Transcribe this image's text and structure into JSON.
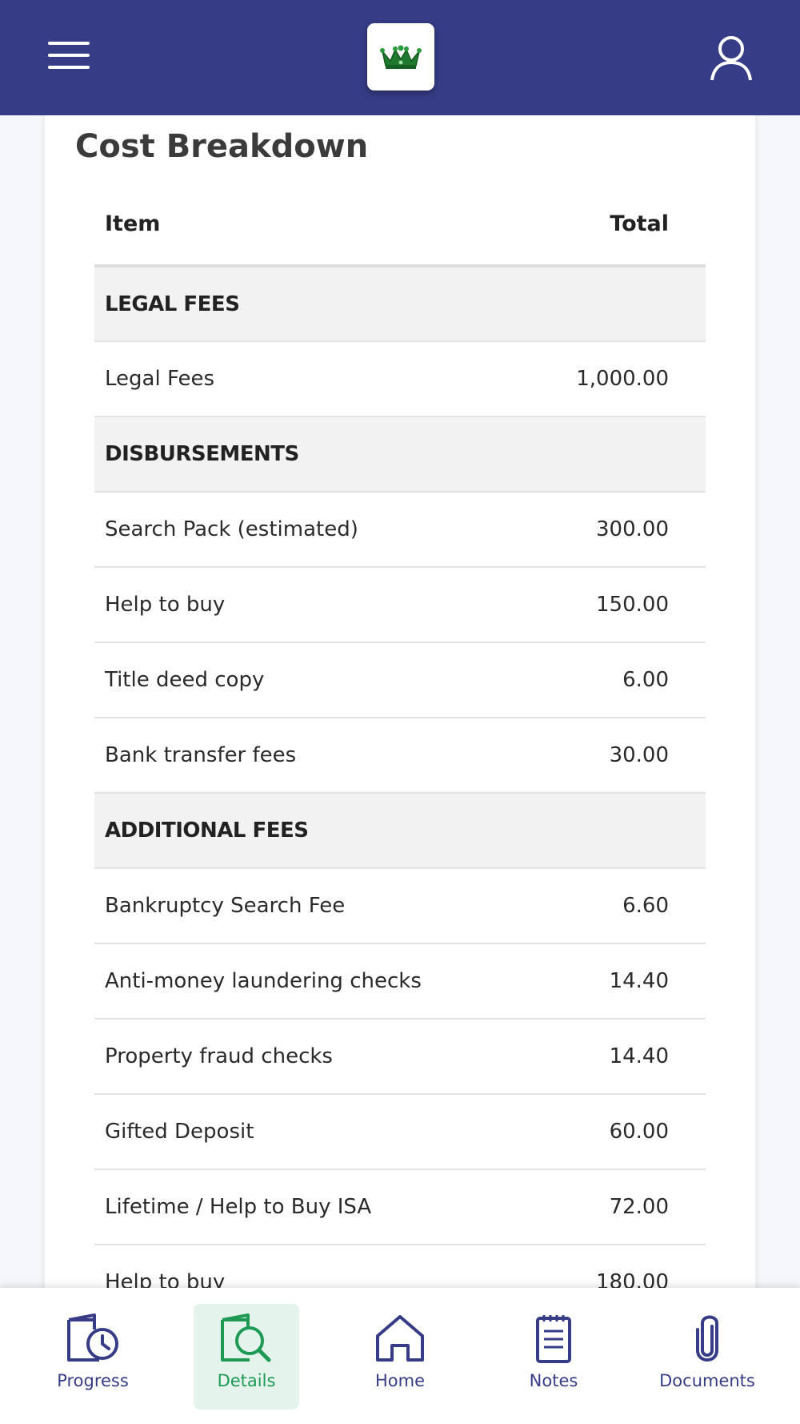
{
  "header": {
    "menu_icon": "hamburger-menu-icon",
    "logo_icon": "crown-logo-icon",
    "profile_icon": "user-profile-icon",
    "brand_color": "#363c85"
  },
  "card": {
    "title": "Cost Breakdown",
    "columns": {
      "item": "Item",
      "total": "Total"
    },
    "rows": [
      {
        "type": "section",
        "label": "LEGAL FEES"
      },
      {
        "type": "item",
        "label": "Legal Fees",
        "total": "1,000.00"
      },
      {
        "type": "section",
        "label": "DISBURSEMENTS"
      },
      {
        "type": "item",
        "label": "Search Pack (estimated)",
        "total": "300.00"
      },
      {
        "type": "item",
        "label": "Help to buy",
        "total": "150.00"
      },
      {
        "type": "item",
        "label": "Title deed copy",
        "total": "6.00"
      },
      {
        "type": "item",
        "label": "Bank transfer fees",
        "total": "30.00"
      },
      {
        "type": "section",
        "label": "ADDITIONAL FEES"
      },
      {
        "type": "item",
        "label": "Bankruptcy Search Fee",
        "total": "6.60"
      },
      {
        "type": "item",
        "label": "Anti-money laundering checks",
        "total": "14.40"
      },
      {
        "type": "item",
        "label": "Property fraud checks",
        "total": "14.40"
      },
      {
        "type": "item",
        "label": "Gifted Deposit",
        "total": "60.00"
      },
      {
        "type": "item",
        "label": "Lifetime / Help to Buy ISA",
        "total": "72.00"
      },
      {
        "type": "item",
        "label": "Help to buy",
        "total": "180.00"
      }
    ]
  },
  "nav": {
    "active_color": "#1e9a55",
    "items": [
      {
        "label": "Progress",
        "icon": "progress-clock-icon",
        "active": false
      },
      {
        "label": "Details",
        "icon": "details-search-icon",
        "active": true
      },
      {
        "label": "Home",
        "icon": "home-icon",
        "active": false
      },
      {
        "label": "Notes",
        "icon": "notes-icon",
        "active": false
      },
      {
        "label": "Documents",
        "icon": "paperclip-icon",
        "active": false
      }
    ]
  }
}
